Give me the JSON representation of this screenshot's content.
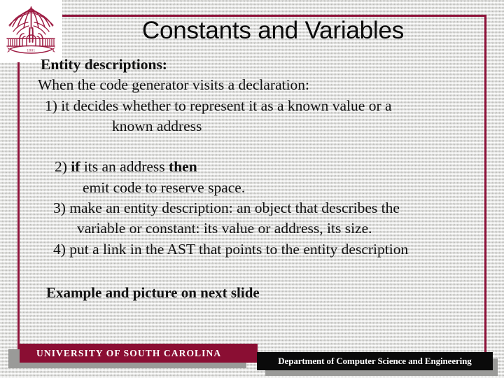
{
  "slide": {
    "title": "Constants and Variables",
    "colors": {
      "maroon": "#8e1139",
      "bar_maroon": "#8a0e33",
      "bar_black": "#0a0a0a",
      "background": "#e9e9e7",
      "shadow": "#9a9a98",
      "text": "#111111"
    },
    "logo": {
      "name": "usc-palmetto-logo",
      "banner_text": "1801"
    },
    "body": [
      {
        "text": "Entity descriptions:",
        "style": "bold",
        "indent": 24
      },
      {
        "text": "When the code generator visits a declaration:",
        "style": "normal",
        "indent": 20
      },
      {
        "text": "1) it decides whether to represent it as a known value or a",
        "style": "normal",
        "indent": 30
      },
      {
        "text": "known address",
        "style": "normal",
        "indent": 126
      },
      {
        "text": "",
        "style": "normal",
        "indent": 0
      },
      {
        "text": "2) if its an address then",
        "style": "mixed",
        "indent": 44,
        "bold_words": [
          "if",
          "then"
        ]
      },
      {
        "text": "emit code to reserve space.",
        "style": "normal",
        "indent": 84
      },
      {
        "text": "3) make an entity description: an object that describes the",
        "style": "normal",
        "indent": 42
      },
      {
        "text": "variable or constant: its value or address, its size.",
        "style": "normal",
        "indent": 76
      },
      {
        "text": "4) put a link in the AST that points to the entity description",
        "style": "normal",
        "indent": 42
      }
    ],
    "body_parts": {
      "line6_a": "2) ",
      "line6_b": "if",
      "line6_c": " its an address ",
      "line6_d": "then"
    },
    "closing": "Example and picture on next slide",
    "footer": {
      "university": "UNIVERSITY OF SOUTH CAROLINA",
      "department": "Department of Computer Science and Engineering"
    }
  }
}
